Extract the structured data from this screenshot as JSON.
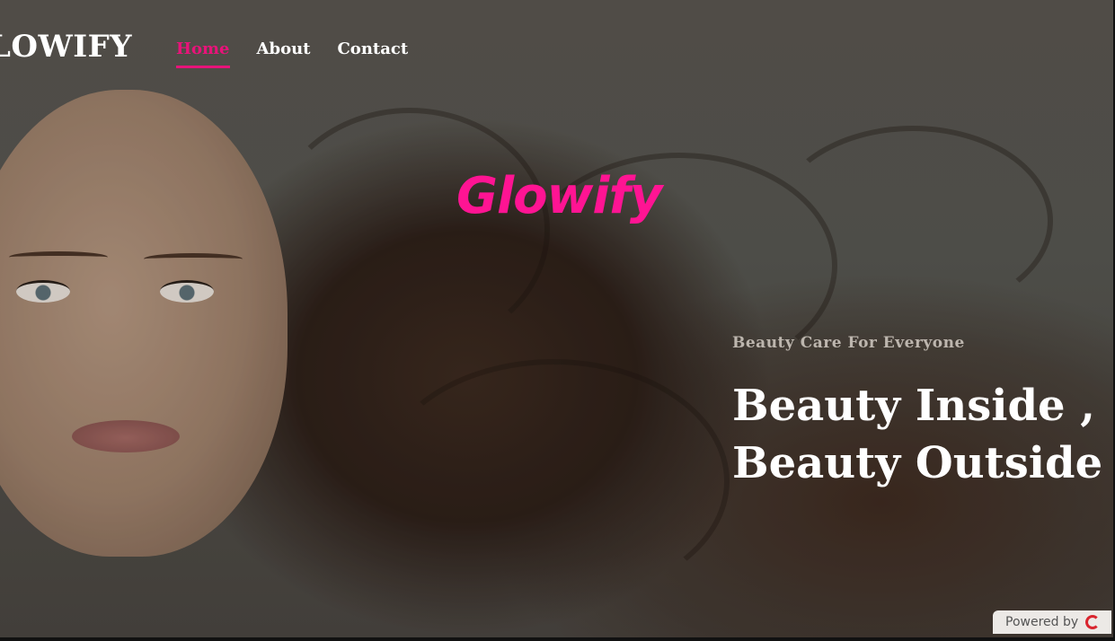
{
  "header": {
    "brand": "LOWIFY",
    "nav": [
      {
        "label": "Home",
        "active": true
      },
      {
        "label": "About",
        "active": false
      },
      {
        "label": "Contact",
        "active": false
      }
    ]
  },
  "hero": {
    "logo_text": "Glowify",
    "tagline": "Beauty Care For Everyone",
    "headline_line1": "Beauty Inside ,",
    "headline_line2": "Beauty Outside"
  },
  "footer_badge": {
    "label": "Powered by",
    "icon": "brand-swirl-icon"
  },
  "colors": {
    "accent": "#e8137a",
    "logo": "#ff1493",
    "text": "#ffffff",
    "tagline": "#bdb6ae"
  }
}
